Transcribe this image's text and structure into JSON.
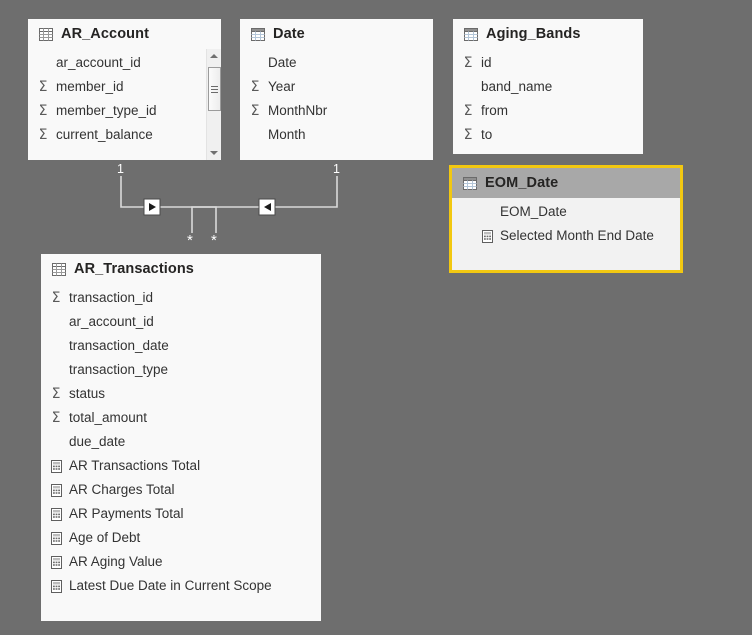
{
  "canvas": {
    "background": "#6e6e6e",
    "accent_selected": "#f2c811",
    "card_background": "#f9f9f9",
    "selected_header_background": "#a8a8a8"
  },
  "tables": [
    {
      "id": "ar-account",
      "name": "AR_Account",
      "icon": "table-icon",
      "selected": false,
      "has_scrollbar": true,
      "fields": [
        {
          "label": "ar_account_id",
          "icon": "none"
        },
        {
          "label": "member_id",
          "icon": "sigma-icon"
        },
        {
          "label": "member_type_id",
          "icon": "sigma-icon"
        },
        {
          "label": "current_balance",
          "icon": "sigma-icon"
        }
      ]
    },
    {
      "id": "date",
      "name": "Date",
      "icon": "date-table-icon",
      "selected": false,
      "has_scrollbar": false,
      "fields": [
        {
          "label": "Date",
          "icon": "none"
        },
        {
          "label": "Year",
          "icon": "sigma-icon"
        },
        {
          "label": "MonthNbr",
          "icon": "sigma-icon"
        },
        {
          "label": "Month",
          "icon": "none"
        }
      ]
    },
    {
      "id": "aging-bands",
      "name": "Aging_Bands",
      "icon": "date-table-icon",
      "selected": false,
      "has_scrollbar": false,
      "fields": [
        {
          "label": "id",
          "icon": "sigma-icon"
        },
        {
          "label": "band_name",
          "icon": "none"
        },
        {
          "label": "from",
          "icon": "sigma-icon"
        },
        {
          "label": "to",
          "icon": "sigma-icon"
        }
      ]
    },
    {
      "id": "eom-date",
      "name": "EOM_Date",
      "icon": "date-table-icon",
      "selected": true,
      "has_scrollbar": false,
      "fields": [
        {
          "label": "EOM_Date",
          "icon": "none"
        },
        {
          "label": "Selected Month End Date",
          "icon": "measure-icon"
        }
      ]
    },
    {
      "id": "ar-transactions",
      "name": "AR_Transactions",
      "icon": "table-icon",
      "selected": false,
      "has_scrollbar": false,
      "fields": [
        {
          "label": "transaction_id",
          "icon": "sigma-icon"
        },
        {
          "label": "ar_account_id",
          "icon": "none"
        },
        {
          "label": "transaction_date",
          "icon": "none"
        },
        {
          "label": "transaction_type",
          "icon": "none"
        },
        {
          "label": "status",
          "icon": "sigma-icon"
        },
        {
          "label": "total_amount",
          "icon": "sigma-icon"
        },
        {
          "label": "due_date",
          "icon": "none"
        },
        {
          "label": "AR Transactions Total",
          "icon": "measure-icon"
        },
        {
          "label": "AR Charges Total",
          "icon": "measure-icon"
        },
        {
          "label": "AR Payments Total",
          "icon": "measure-icon"
        },
        {
          "label": "Age of Debt",
          "icon": "measure-icon"
        },
        {
          "label": "AR Aging Value",
          "icon": "measure-icon"
        },
        {
          "label": "Latest Due Date in Current Scope",
          "icon": "measure-icon"
        }
      ]
    }
  ],
  "relationships": [
    {
      "id": "ar-account-to-ar-transactions",
      "from_table": "AR_Account",
      "to_table": "AR_Transactions",
      "from_cardinality": "1",
      "to_cardinality": "*",
      "cross_filter_direction": "single-right"
    },
    {
      "id": "date-to-ar-transactions",
      "from_table": "Date",
      "to_table": "AR_Transactions",
      "from_cardinality": "1",
      "to_cardinality": "*",
      "cross_filter_direction": "single-left"
    }
  ]
}
